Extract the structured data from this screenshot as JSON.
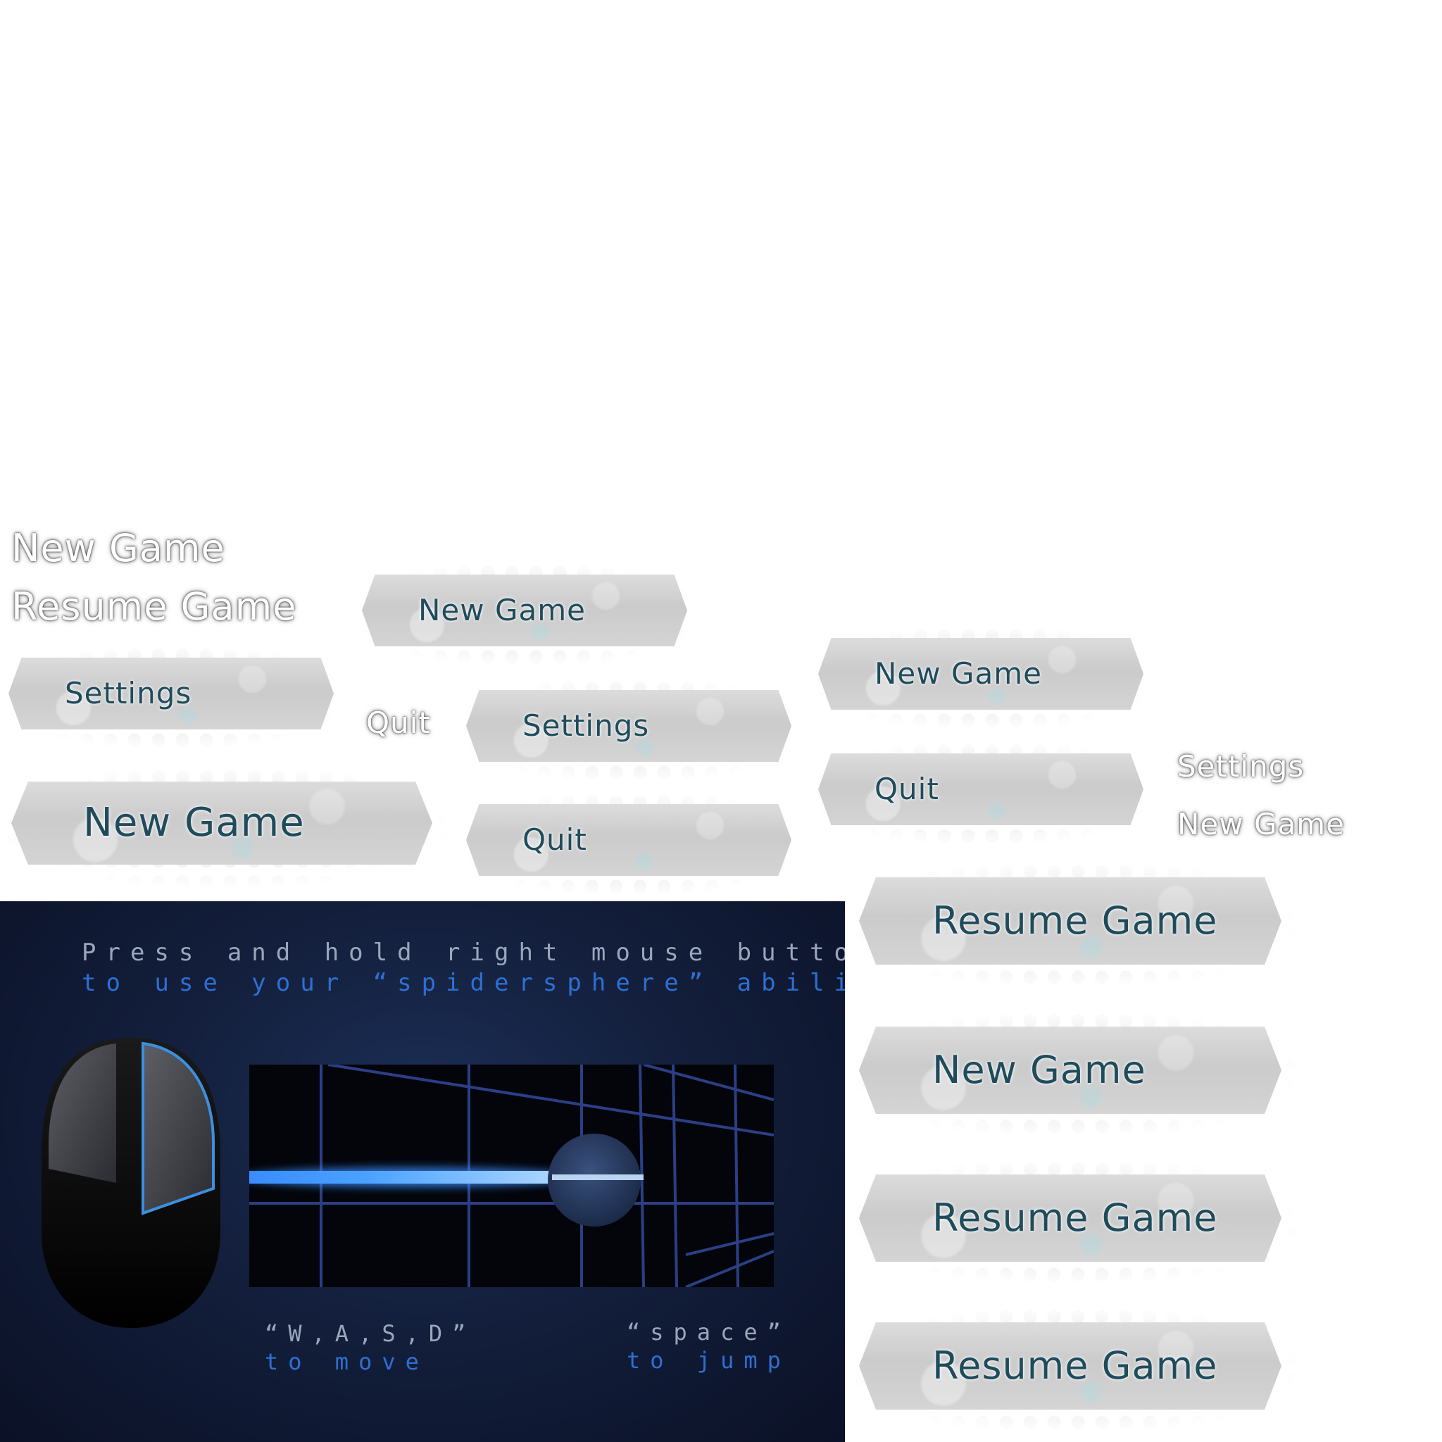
{
  "plain_labels": {
    "new_game_1": "New Game",
    "resume_game_1": "Resume Game",
    "quit_1": "Quit",
    "settings_1": "Settings",
    "new_game_2": "New Game"
  },
  "buttons": {
    "new_game_a": "New Game",
    "settings_a": "Settings",
    "new_game_large": "New Game",
    "settings_b": "Settings",
    "quit_a": "Quit",
    "new_game_b": "New Game",
    "quit_b": "Quit",
    "resume_game_a": "Resume Game",
    "new_game_c": "New Game",
    "resume_game_b": "Resume Game",
    "resume_game_c": "Resume Game"
  },
  "tutorial": {
    "line1": "Press and hold right mouse button",
    "line2": "to use your “spidersphere” ability",
    "wasd_key": "“W,A,S,D”",
    "wasd_action": "to move",
    "space_key": "“space”",
    "space_action": "to jump"
  },
  "colors": {
    "button_text": "#1f4c5c",
    "panel_bg": "#131f3c",
    "accent_blue": "#2e6fd2",
    "beam": "#5aa8ff"
  }
}
